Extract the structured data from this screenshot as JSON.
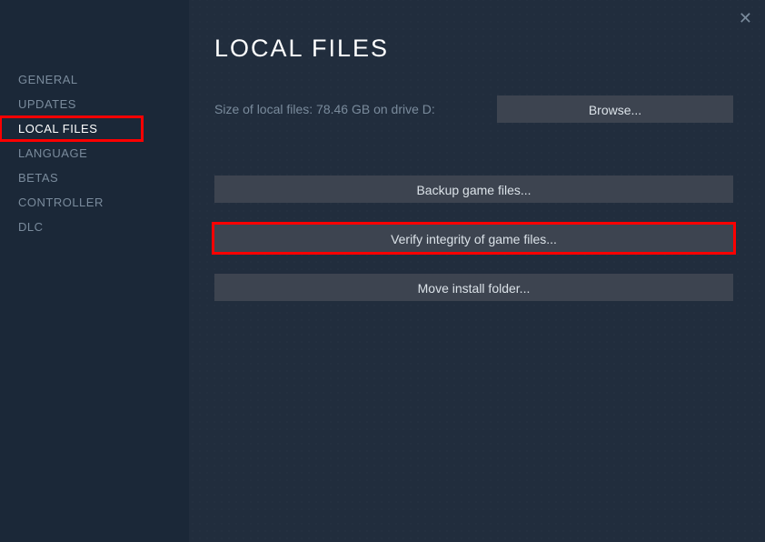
{
  "sidebar": {
    "items": [
      {
        "label": "GENERAL"
      },
      {
        "label": "UPDATES"
      },
      {
        "label": "LOCAL FILES"
      },
      {
        "label": "LANGUAGE"
      },
      {
        "label": "BETAS"
      },
      {
        "label": "CONTROLLER"
      },
      {
        "label": "DLC"
      }
    ]
  },
  "main": {
    "title": "LOCAL FILES",
    "size_text": "Size of local files: 78.46 GB on drive D:",
    "browse_label": "Browse...",
    "backup_label": "Backup game files...",
    "verify_label": "Verify integrity of game files...",
    "move_label": "Move install folder..."
  }
}
